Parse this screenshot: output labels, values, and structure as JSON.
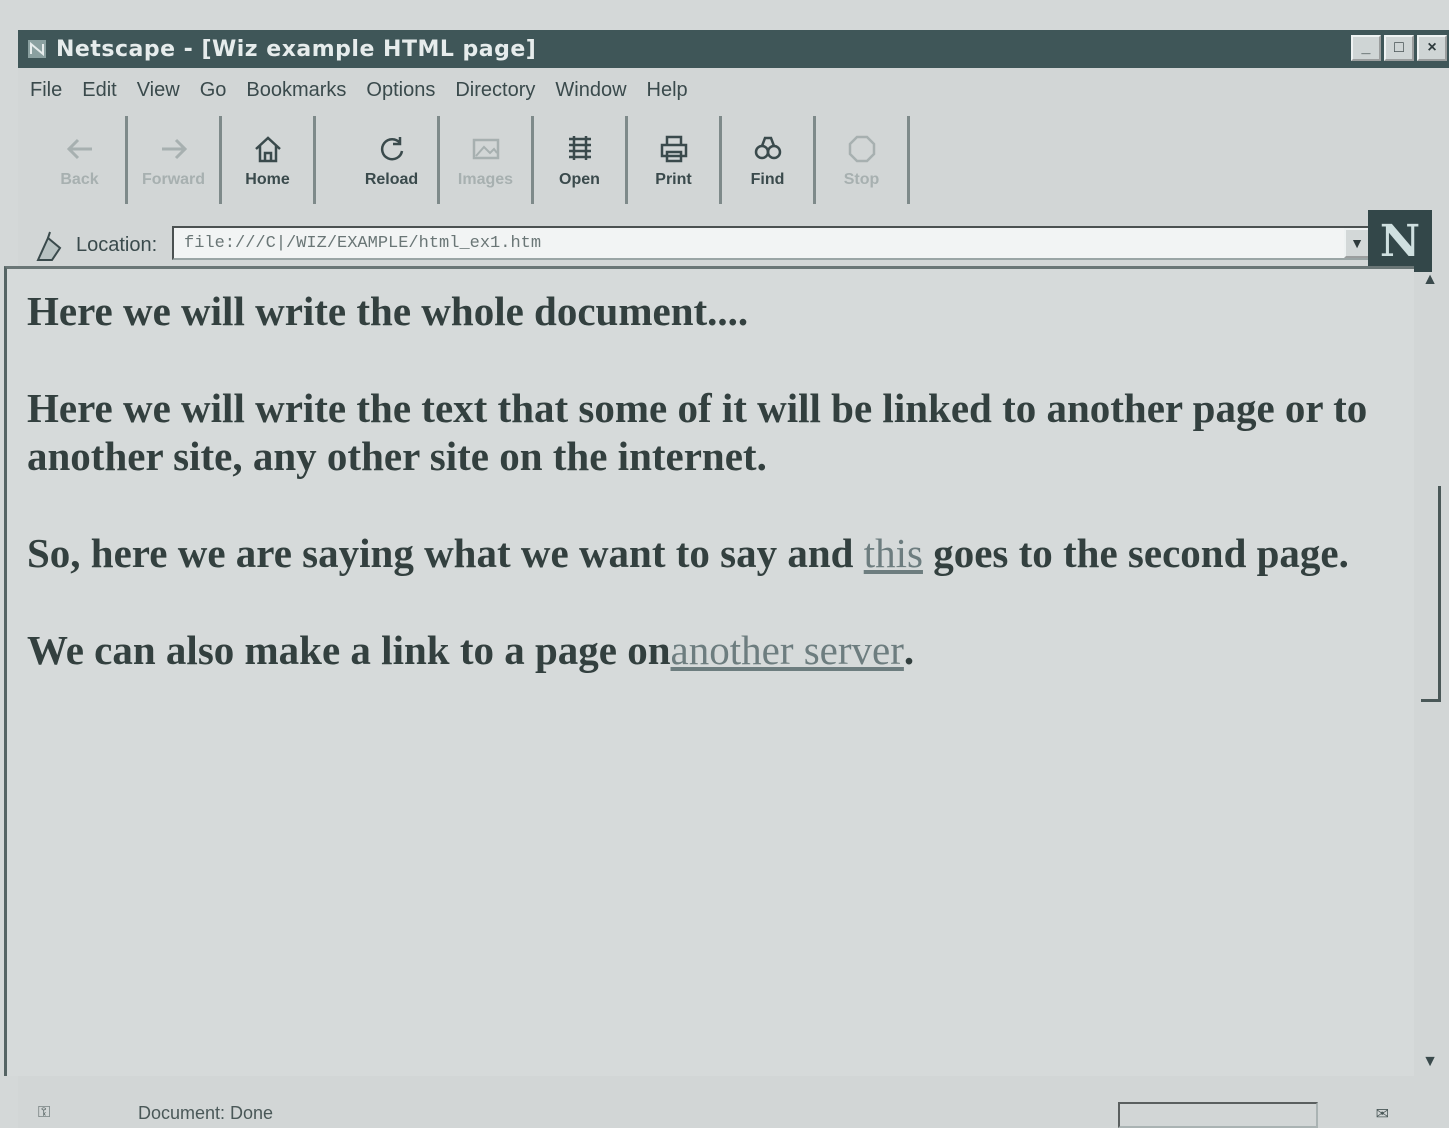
{
  "window": {
    "title": "Netscape - [Wiz example HTML page]",
    "controls": [
      "_",
      "□",
      "×"
    ]
  },
  "menu": [
    "File",
    "Edit",
    "View",
    "Go",
    "Bookmarks",
    "Options",
    "Directory",
    "Window",
    "Help"
  ],
  "toolbar": [
    {
      "label": "Back",
      "icon": "back-arrow-icon",
      "enabled": false
    },
    {
      "label": "Forward",
      "icon": "forward-arrow-icon",
      "enabled": false
    },
    {
      "label": "Home",
      "icon": "home-icon",
      "enabled": true
    },
    {
      "label": "Reload",
      "icon": "reload-icon",
      "enabled": true
    },
    {
      "label": "Images",
      "icon": "images-icon",
      "enabled": false
    },
    {
      "label": "Open",
      "icon": "open-icon",
      "enabled": true
    },
    {
      "label": "Print",
      "icon": "print-icon",
      "enabled": true
    },
    {
      "label": "Find",
      "icon": "find-icon",
      "enabled": true
    },
    {
      "label": "Stop",
      "icon": "stop-icon",
      "enabled": false
    }
  ],
  "location": {
    "label": "Location:",
    "url": "file:///C|/WIZ/EXAMPLE/html_ex1.htm"
  },
  "logo": "N",
  "document": {
    "p1": "Here we will write the whole document....",
    "p2": "Here we will write the text that some of it will be linked to another page or to another site, any other site on the internet.",
    "p3_before": "So, here we are saying what we want to say and ",
    "p3_link": "this",
    "p3_after": " goes to the second page.",
    "p4_before": "We can also make a link to a page on",
    "p4_link": "another server",
    "p4_after": "."
  },
  "status": {
    "text": "Document: Done"
  },
  "colors": {
    "titlebar": "#3f5658",
    "background": "#d6dada",
    "text": "#33403f",
    "link": "#6d7d7f"
  }
}
